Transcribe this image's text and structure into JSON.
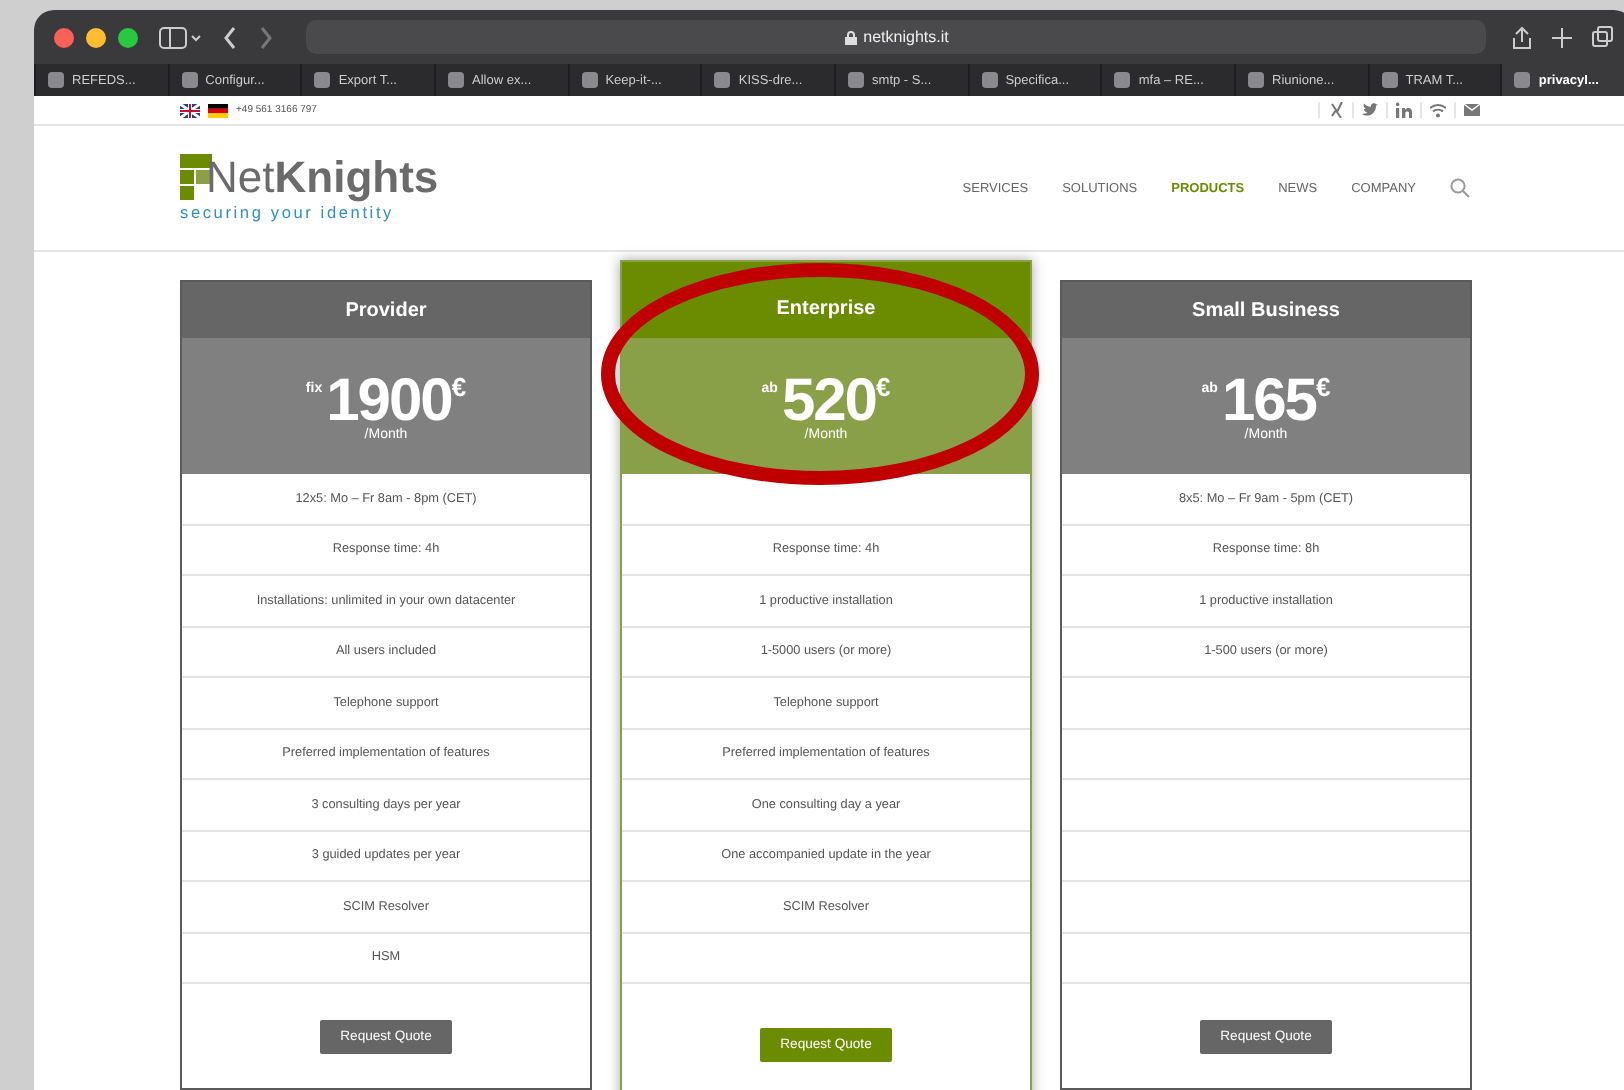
{
  "browser": {
    "address": "netknights.it",
    "tabs": [
      {
        "label": "REFEDS...",
        "selected": false
      },
      {
        "label": "Configur...",
        "selected": false
      },
      {
        "label": "Export T...",
        "selected": false
      },
      {
        "label": "Allow ex...",
        "selected": false
      },
      {
        "label": "Keep-it-...",
        "selected": false
      },
      {
        "label": "KISS-dre...",
        "selected": false
      },
      {
        "label": "smtp - S...",
        "selected": false
      },
      {
        "label": "Specifica...",
        "selected": false
      },
      {
        "label": "mfa – RE...",
        "selected": false
      },
      {
        "label": "Riunione...",
        "selected": false
      },
      {
        "label": "TRAM T...",
        "selected": false
      },
      {
        "label": "privacyI...",
        "selected": true
      }
    ]
  },
  "topbar": {
    "phone": "+49 561 3166 797"
  },
  "header": {
    "logo": {
      "name_light": "Net",
      "name_bold": "Knights",
      "tagline": "securing your identity"
    },
    "nav": [
      {
        "label": "SERVICES",
        "selected": false
      },
      {
        "label": "SOLUTIONS",
        "selected": false
      },
      {
        "label": "PRODUCTS",
        "selected": true
      },
      {
        "label": "NEWS",
        "selected": false
      },
      {
        "label": "COMPANY",
        "selected": false
      }
    ]
  },
  "plans": [
    {
      "name": "Provider",
      "highlighted": false,
      "prefix": "fix",
      "price": "1900",
      "currency": "€",
      "period": "/Month",
      "button": "Request Quote",
      "features": [
        {
          "kind": "text",
          "text": "12x5: Mo – Fr 8am - 8pm (CET)"
        },
        {
          "kind": "text",
          "text": "Response time: 4h"
        },
        {
          "kind": "text",
          "text": "Installations: unlimited in your own datacenter"
        },
        {
          "kind": "text",
          "text": "All users included"
        },
        {
          "kind": "text",
          "text": "Telephone support"
        },
        {
          "kind": "text",
          "text": "Preferred implementation of features"
        },
        {
          "kind": "text",
          "text": "3 consulting days per year"
        },
        {
          "kind": "text",
          "text": "3 guided updates per year"
        },
        {
          "kind": "text",
          "text": "SCIM Resolver"
        },
        {
          "kind": "text",
          "text": "HSM"
        }
      ]
    },
    {
      "name": "Enterprise",
      "highlighted": true,
      "prefix": "ab",
      "price": "520",
      "currency": "€",
      "period": "/Month",
      "button": "Request Quote",
      "features": [
        {
          "kind": "covered"
        },
        {
          "kind": "text",
          "text": "Response time: 4h"
        },
        {
          "kind": "text",
          "text": "1 productive installation"
        },
        {
          "kind": "text",
          "text": "1-5000 users (or more)"
        },
        {
          "kind": "text",
          "text": "Telephone support"
        },
        {
          "kind": "text",
          "text": "Preferred implementation of features"
        },
        {
          "kind": "text",
          "text": "One consulting day a year"
        },
        {
          "kind": "text",
          "text": "One accompanied update in the year"
        },
        {
          "kind": "text",
          "text": "SCIM Resolver"
        }
      ]
    },
    {
      "name": "Small Business",
      "highlighted": false,
      "prefix": "ab",
      "price": "165",
      "currency": "€",
      "period": "/Month",
      "button": "Request Quote",
      "features": [
        {
          "kind": "text",
          "text": "8x5: Mo – Fr 9am - 5pm (CET)"
        },
        {
          "kind": "text",
          "text": "Response time: 8h"
        },
        {
          "kind": "text",
          "text": "1 productive installation"
        },
        {
          "kind": "text",
          "text": "1-500 users (or more)"
        }
      ]
    }
  ]
}
